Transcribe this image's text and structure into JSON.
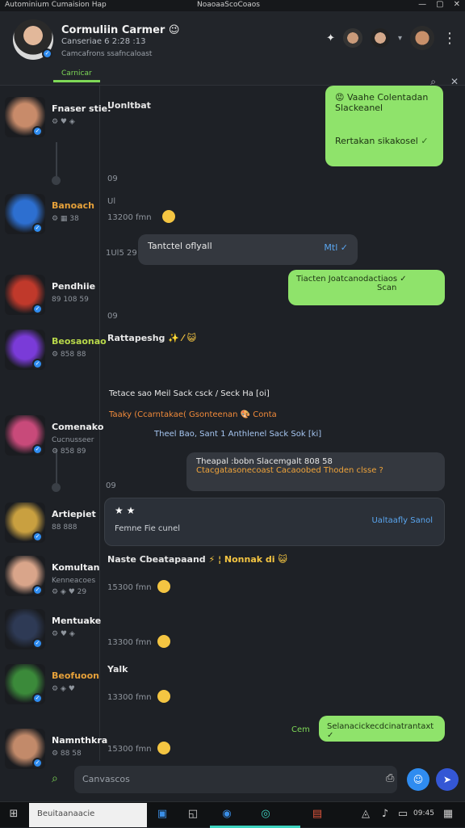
{
  "titlebar": {
    "app_title": "Autominium Cumaision Hap",
    "center_title": "NoaoaaScoCoaos",
    "min": "—",
    "max": "▢",
    "close": "✕"
  },
  "header": {
    "name": "Cormuliin Carmer",
    "name_emoji": "😉",
    "subtitle": "Canseriae 6 2:28 :13",
    "status": "Camcafrons ssafncaloast",
    "tab_label": "Carnicar"
  },
  "toolbar": {
    "search_icon": "⌕",
    "close_icon": "✕",
    "pin_icon": "✦",
    "more_icon": "⋮"
  },
  "sidebar": {
    "contacts": [
      {
        "name": "Fnaser stie:",
        "meta": "⚙ ♥ ◈",
        "color": "#c88b6a"
      },
      {
        "name": "Banoach",
        "meta": "⚙ ▦ 38",
        "color": "#2d6fd0",
        "name_color": "#e6a13a"
      },
      {
        "name": "Pendhiie",
        "meta": "89 108 59",
        "color": "#c0392b"
      },
      {
        "name": "Beosaonao",
        "meta": "⚙ 858 88",
        "color": "#7a3bd8",
        "name_color": "#b8d84a"
      },
      {
        "name": "Comenako",
        "meta": "Cucnusseer",
        "meta2": "⚙ 858 89",
        "color": "#c84a7a"
      },
      {
        "name": "Artiepiet",
        "meta": "88 888",
        "color": "#c9a040"
      },
      {
        "name": "Komultan",
        "meta": "Kenneacoes",
        "meta2": "⚙ ◈ ♥ 29",
        "color": "#d9a58a"
      },
      {
        "name": "Mentuake",
        "meta": "⚙ ♥ ◈",
        "color": "#2e3a55"
      },
      {
        "name": "Beofuoon",
        "meta": "⚙ ◈ ♥",
        "color": "#3b8a3a",
        "name_color": "#e6a13a"
      },
      {
        "name": "Namnthkra",
        "meta": "⚙ 88 58",
        "color": "#c28a6a"
      }
    ]
  },
  "messages": {
    "m1_title": "Uonltbat",
    "m1_time": "09",
    "out1": {
      "line1": "😡 Vaahe Colentadan",
      "line2": "Slackeanel",
      "line3": "Rertakan sikakosel",
      "check": "✓"
    },
    "time2": "Ul",
    "time2b": "13200 fmn",
    "time3": "1Ul5 29",
    "in1": {
      "text": "Tantctel oflyall",
      "right": "Mtl ✓"
    },
    "out2": {
      "line1": "Tiacten Joatcanodactiaos ✓",
      "line2": "Scan"
    },
    "time4": "09",
    "m5": "Rattapeshg",
    "m5_tail": "✨ ⁄ 😺",
    "rich1": "Tetace sao Meil Sack csck / Seck Ha [oi]",
    "rich2": "Taaky (Ccarntakae( Gsonteenan 🎨 Conta",
    "rich3": "Theel Bao, Sant 1 Anthlenel Sack Sok [ki]",
    "in2": {
      "line1": "Theapal :bobn Slacemgalt 808 58",
      "line2": "Ctacgatasonecoast Cacaoobed Thoden clsse ?"
    },
    "time6": "09",
    "card": {
      "stars": "★ ★",
      "title": "Femne Fie cunel",
      "action": "Ualtaafly Sanol"
    },
    "m7": "Naste Cbeatapaand",
    "m7_tail": "⚡ ¦ Nonnak di 😺",
    "time7": "15300 fmn",
    "time8": "13300 fmn",
    "m9": "Yalk",
    "time9": "13300 fmn",
    "out3": {
      "prefix": "Cem",
      "text": "Selanacickecdcinatrantaxt ✓"
    },
    "time10": "15300 fmn"
  },
  "composer": {
    "placeholder": "Canvascos",
    "attach_icon": "⎙",
    "send_icon": "➤"
  },
  "taskbar": {
    "search_placeholder": "Beuitaanaacie",
    "clock": "09:45"
  }
}
